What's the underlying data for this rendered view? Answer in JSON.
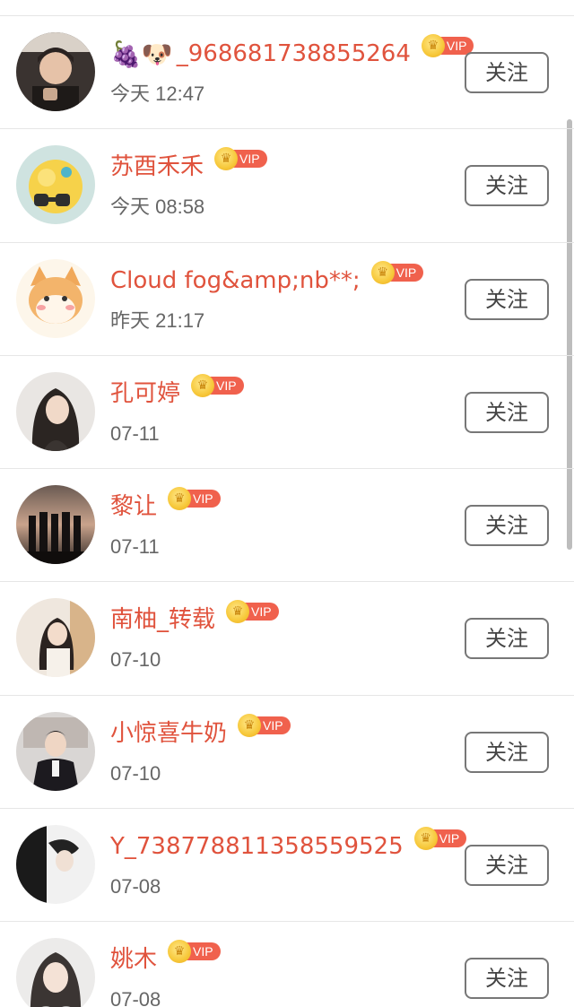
{
  "follow_label": "关注",
  "vip_label": "VIP",
  "users": [
    {
      "name": "_968681738855264",
      "prefix_emoji": "🍇🐶",
      "time": "今天 12:47"
    },
    {
      "name": "苏酉禾禾",
      "prefix_emoji": "",
      "time": "今天 08:58"
    },
    {
      "name": "Cloud fog&amp;nb**;",
      "prefix_emoji": "",
      "time": "昨天 21:17"
    },
    {
      "name": "孔可婷",
      "prefix_emoji": "",
      "time": "07-11"
    },
    {
      "name": "黎让",
      "prefix_emoji": "",
      "time": "07-11"
    },
    {
      "name": "南柚_转载",
      "prefix_emoji": "",
      "time": "07-10"
    },
    {
      "name": "小惊喜牛奶",
      "prefix_emoji": "",
      "time": "07-10"
    },
    {
      "name": "Y_738778811358559525",
      "prefix_emoji": "",
      "time": "07-08"
    },
    {
      "name": "姚木",
      "prefix_emoji": "",
      "time": "07-08"
    }
  ],
  "colors": {
    "name": "#e0533d",
    "vip_tag": "#f0614d",
    "crown": "#f7c83a",
    "button_border": "#777777",
    "divider": "#e6e6e6"
  }
}
